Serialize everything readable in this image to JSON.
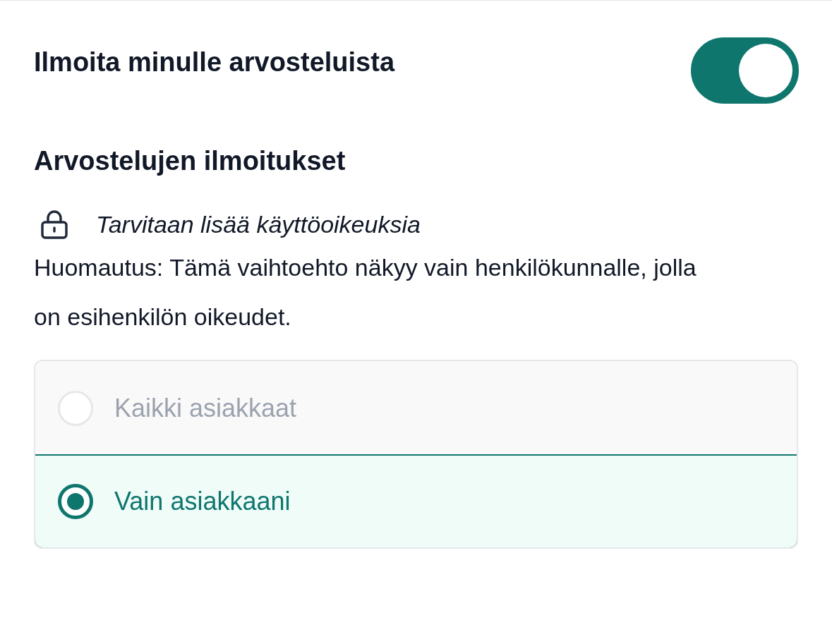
{
  "notify": {
    "label": "Ilmoita minulle arvosteluista",
    "on": true
  },
  "section": {
    "title": "Arvostelujen ilmoitukset",
    "permission": "Tarvitaan lisää käyttöoikeuksia",
    "note": "Huomautus: Tämä vaihtoehto näkyy vain henkilökunnalle, jolla on esihenkilön oikeudet."
  },
  "options": [
    {
      "label": "Kaikki asiakkaat",
      "selected": false
    },
    {
      "label": "Vain asiakkaani",
      "selected": true
    }
  ]
}
